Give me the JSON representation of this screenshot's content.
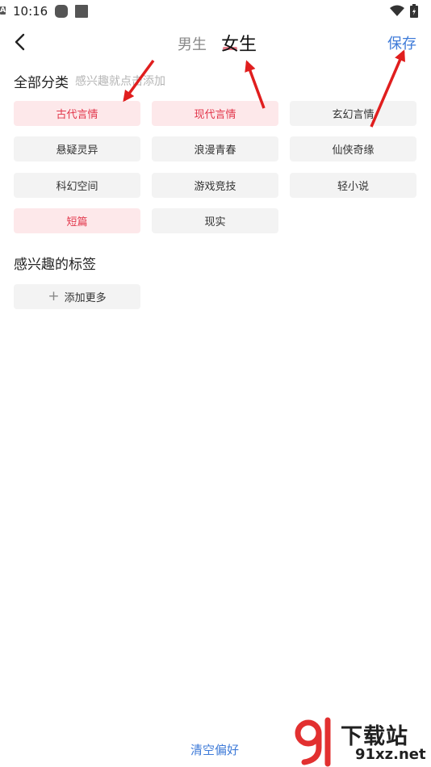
{
  "status": {
    "time": "10:16",
    "icon_letter": "A"
  },
  "header": {
    "tab_male": "男生",
    "tab_female": "女生",
    "save_label": "保存"
  },
  "all_categories": {
    "title": "全部分类",
    "hint": "感兴趣就点击添加",
    "items": [
      {
        "label": "古代言情",
        "selected": true
      },
      {
        "label": "现代言情",
        "selected": true
      },
      {
        "label": "玄幻言情",
        "selected": false
      },
      {
        "label": "悬疑灵异",
        "selected": false
      },
      {
        "label": "浪漫青春",
        "selected": false
      },
      {
        "label": "仙侠奇缘",
        "selected": false
      },
      {
        "label": "科幻空间",
        "selected": false
      },
      {
        "label": "游戏竞技",
        "selected": false
      },
      {
        "label": "轻小说",
        "selected": false
      },
      {
        "label": "短篇",
        "selected": true
      },
      {
        "label": "现实",
        "selected": false
      }
    ]
  },
  "interest_tags": {
    "title": "感兴趣的标签",
    "add_more_label": "添加更多"
  },
  "footer": {
    "clear_label": "清空偏好"
  },
  "watermark": {
    "brand": "下载站",
    "domain": "91xz.net"
  },
  "colors": {
    "accent": "#3f7bd8",
    "selected_text": "#e2384c",
    "selected_bg": "#fde8ea",
    "annotation": "#e01e1e"
  }
}
